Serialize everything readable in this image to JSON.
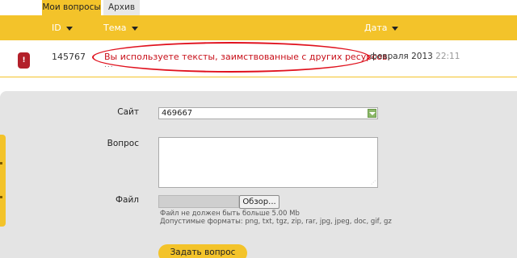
{
  "tabs": [
    {
      "label": "Мои вопросы",
      "active": true
    },
    {
      "label": "Архив",
      "active": false
    }
  ],
  "table": {
    "columns": {
      "id": "ID",
      "subject": "Тема",
      "date": "Дата"
    },
    "rows": [
      {
        "status": "!",
        "id": "145767",
        "subject": "Вы используете тексты, заимствованные с других ресурсов.",
        "more": "...",
        "date": "февраля 2013",
        "time": "22:11"
      }
    ]
  },
  "form": {
    "site_label": "Сайт",
    "site_value": "469667",
    "question_label": "Вопрос",
    "question_value": "",
    "file_label": "Файл",
    "browse_label": "Обзор...",
    "size_hint": "Файл не должен быть больше 5.00 Mb",
    "formats_hint": "Допустимые форматы: png, txt, tgz, zip, rar, jpg, jpeg, doc, gif, gz",
    "submit_label": "Задать вопрос"
  },
  "colors": {
    "accent": "#f3c32a",
    "status": "#b3202a",
    "highlight": "#e0121e",
    "subject_text": "#c8101a"
  }
}
